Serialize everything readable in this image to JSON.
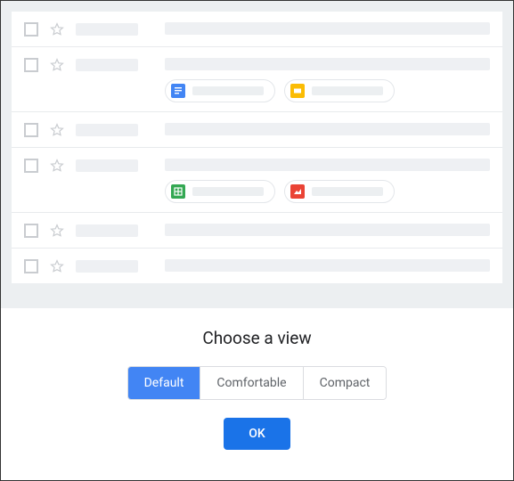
{
  "title": "Choose a view",
  "options": {
    "default": "Default",
    "comfortable": "Comfortable",
    "compact": "Compact"
  },
  "selected": "default",
  "ok_label": "OK",
  "icons": {
    "docs": {
      "bg": "#4285f4",
      "glyph": "doc"
    },
    "slides": {
      "bg": "#fbbc04",
      "glyph": "slide"
    },
    "sheets": {
      "bg": "#34a853",
      "glyph": "sheet"
    },
    "image": {
      "bg": "#ea4335",
      "glyph": "image"
    }
  },
  "rows": [
    {
      "chips": []
    },
    {
      "chips": [
        "docs",
        "slides"
      ]
    },
    {
      "chips": []
    },
    {
      "chips": [
        "sheets",
        "image"
      ]
    },
    {
      "chips": []
    },
    {
      "chips": []
    }
  ]
}
